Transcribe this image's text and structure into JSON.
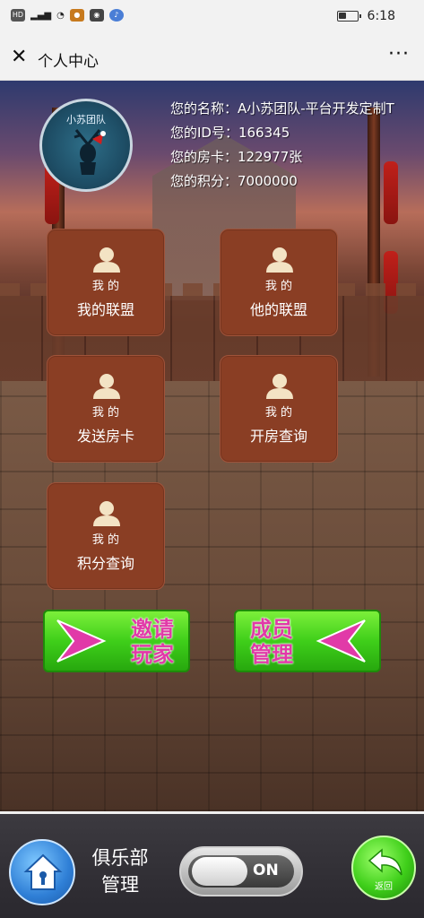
{
  "statusbar": {
    "left_icons": [
      "HD",
      "4G",
      "signal",
      "wifi",
      "app1",
      "app2",
      "wechat",
      "music"
    ],
    "battery_level": 0.4,
    "time": "6:18"
  },
  "navbar": {
    "close_symbol": "✕",
    "title": "个人中心",
    "more_symbol": "···"
  },
  "avatar": {
    "team_text": "小苏团队"
  },
  "profile": {
    "name_line": "您的名称：A小苏团队-平台开发定制T",
    "id_line": "您的ID号：166345",
    "card_line": "您的房卡：122977张",
    "points_line": "您的积分：7000000"
  },
  "menu": {
    "tiles": [
      {
        "sub": "我 的",
        "label": "我的联盟"
      },
      {
        "sub": "我 的",
        "label": "他的联盟"
      },
      {
        "sub": "我 的",
        "label": "发送房卡"
      },
      {
        "sub": "我 的",
        "label": "开房查询"
      },
      {
        "sub": "我 的",
        "label": "积分查询"
      }
    ]
  },
  "actions": {
    "invite_line1": "邀请",
    "invite_line2": "玩家",
    "members_line1": "成员",
    "members_line2": "管理"
  },
  "bottom": {
    "club_line1": "俱乐部",
    "club_line2": "管理",
    "toggle_text": "ON",
    "back_label": "返回"
  },
  "colors": {
    "tile": "#8a3e24",
    "button_green": "#3fcf1a",
    "button_text": "#e13aa8"
  }
}
